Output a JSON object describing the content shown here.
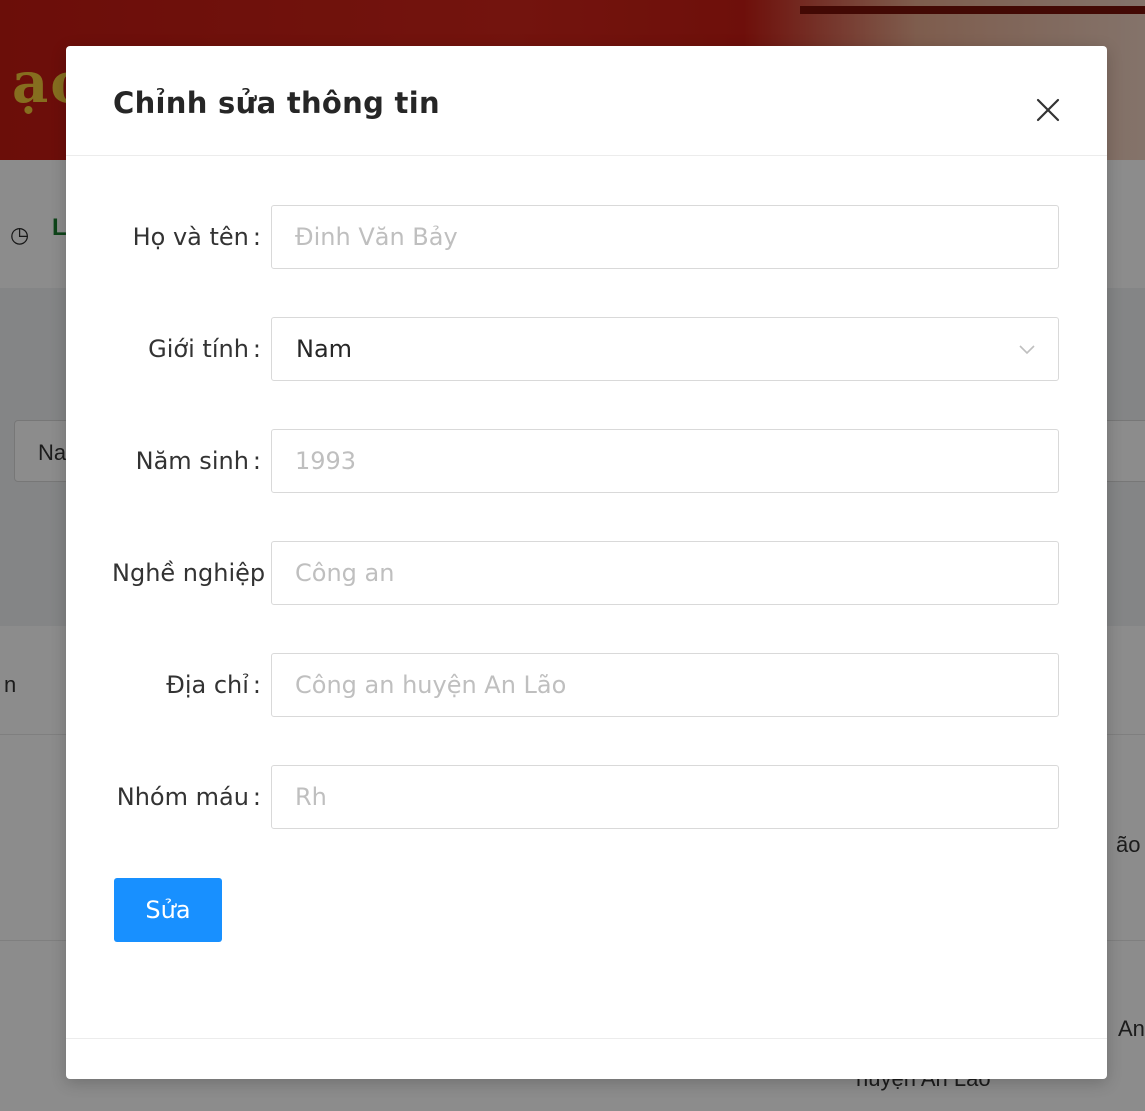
{
  "background": {
    "search_value": "Na",
    "col_fragment_header": "n",
    "col_fragment_row1": "ão",
    "col_fragment_row2": "An",
    "col_fragment_row3": "huyện An Lão"
  },
  "modal": {
    "title": "Chỉnh sửa thông tin",
    "close_glyph": "×",
    "fields": {
      "full_name": {
        "label": "Họ và tên",
        "colon": ":",
        "placeholder": "Đinh Văn Bảy"
      },
      "gender": {
        "label": "Giới tính",
        "colon": ":",
        "value": "Nam"
      },
      "birth_year": {
        "label": "Năm sinh",
        "colon": ":",
        "placeholder": "1993"
      },
      "occupation": {
        "label": "Nghề nghiệp",
        "colon": ":",
        "placeholder": "Công an"
      },
      "address": {
        "label": "Địa chỉ",
        "colon": ":",
        "placeholder": "Công an huyện An Lão"
      },
      "blood_type": {
        "label": "Nhóm máu",
        "colon": ":",
        "placeholder": "Rh"
      }
    },
    "submit_label": "Sửa"
  },
  "colors": {
    "primary": "#1890ff",
    "banner_red": "#c41a12",
    "banner_gold": "#f5c93a",
    "overlay": "rgba(0,0,0,0.45)"
  }
}
